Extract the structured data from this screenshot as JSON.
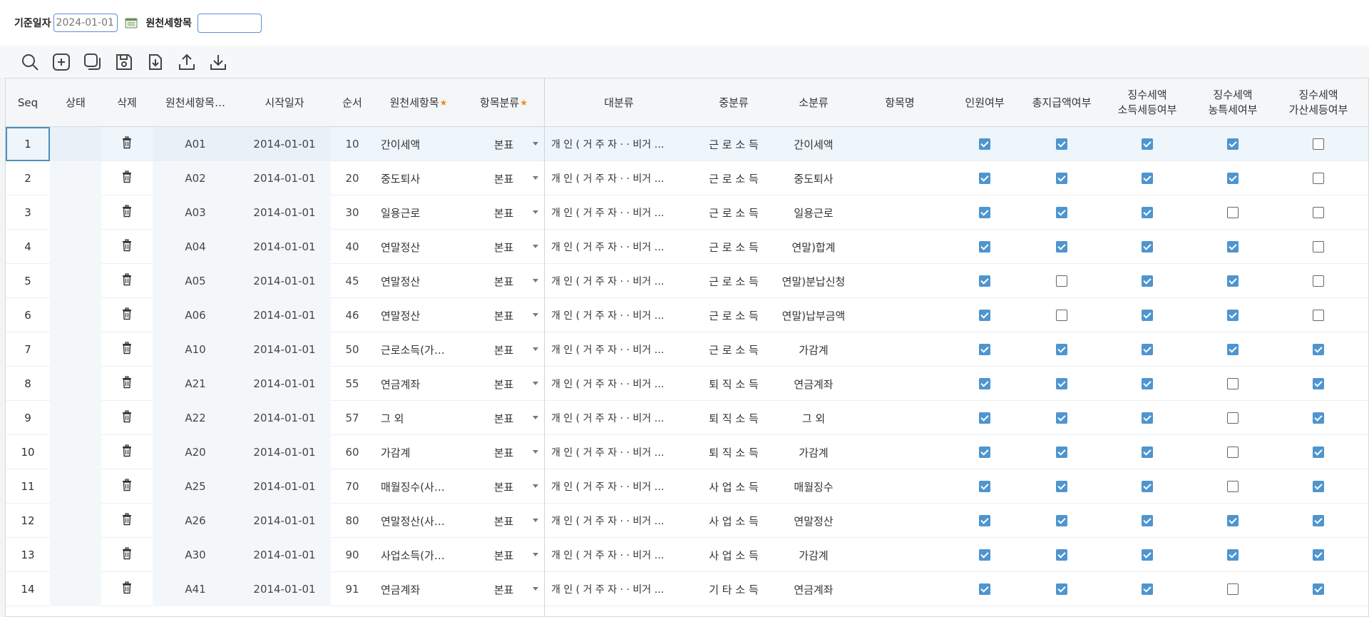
{
  "search": {
    "date_label": "기준일자",
    "date_value": "2024-01-01",
    "item_label": "원천세항목",
    "item_value": ""
  },
  "toolbar": {
    "buttons": [
      "search-icon",
      "add-icon",
      "copy-icon",
      "save-icon",
      "download-file-icon",
      "upload-icon",
      "download-icon"
    ]
  },
  "columns": {
    "seq": "Seq",
    "status": "상태",
    "delete": "삭제",
    "code": "원천세항목…",
    "start_date": "시작일자",
    "order": "순서",
    "item": "원천세항목",
    "category": "항목분류",
    "major": "대분류",
    "middle": "중분류",
    "minor": "소분류",
    "item_name": "항목명",
    "headcount": "인원여부",
    "total_pay": "총지급액여부",
    "income_tax_line1": "징수세액",
    "income_tax_line2": "소득세등여부",
    "rural_tax_line1": "징수세액",
    "rural_tax_line2": "농특세여부",
    "penalty_tax_line1": "징수세액",
    "penalty_tax_line2": "가산세등여부"
  },
  "rows": [
    {
      "seq": "1",
      "code": "A01",
      "start": "2014-01-01",
      "order": "10",
      "item": "간이세액",
      "category": "본표",
      "major": "개 인 ( 거 주 자 ·  · 비거 …",
      "middle": "근 로 소 득",
      "minor": "간이세액",
      "name": "",
      "headcount": true,
      "total": true,
      "income": true,
      "rural": true,
      "penalty": false
    },
    {
      "seq": "2",
      "code": "A02",
      "start": "2014-01-01",
      "order": "20",
      "item": "중도퇴사",
      "category": "본표",
      "major": "개 인 ( 거 주 자 ·  · 비거 …",
      "middle": "근 로 소 득",
      "minor": "중도퇴사",
      "name": "",
      "headcount": true,
      "total": true,
      "income": true,
      "rural": true,
      "penalty": false
    },
    {
      "seq": "3",
      "code": "A03",
      "start": "2014-01-01",
      "order": "30",
      "item": "일용근로",
      "category": "본표",
      "major": "개 인 ( 거 주 자 ·  · 비거 …",
      "middle": "근 로 소 득",
      "minor": "일용근로",
      "name": "",
      "headcount": true,
      "total": true,
      "income": true,
      "rural": false,
      "penalty": false
    },
    {
      "seq": "4",
      "code": "A04",
      "start": "2014-01-01",
      "order": "40",
      "item": "연말정산",
      "category": "본표",
      "major": "개 인 ( 거 주 자 ·  · 비거 …",
      "middle": "근 로 소 득",
      "minor": "연말)합계",
      "name": "",
      "headcount": true,
      "total": true,
      "income": true,
      "rural": true,
      "penalty": false
    },
    {
      "seq": "5",
      "code": "A05",
      "start": "2014-01-01",
      "order": "45",
      "item": "연말정산",
      "category": "본표",
      "major": "개 인 ( 거 주 자 ·  · 비거 …",
      "middle": "근 로 소 득",
      "minor": "연말)분납신청",
      "name": "",
      "headcount": true,
      "total": false,
      "income": true,
      "rural": true,
      "penalty": false
    },
    {
      "seq": "6",
      "code": "A06",
      "start": "2014-01-01",
      "order": "46",
      "item": "연말정산",
      "category": "본표",
      "major": "개 인 ( 거 주 자 ·  · 비거 …",
      "middle": "근 로 소 득",
      "minor": "연말)납부금액",
      "name": "",
      "headcount": true,
      "total": false,
      "income": true,
      "rural": true,
      "penalty": false
    },
    {
      "seq": "7",
      "code": "A10",
      "start": "2014-01-01",
      "order": "50",
      "item": "근로소득(가…",
      "category": "본표",
      "major": "개 인 ( 거 주 자 ·  · 비거 …",
      "middle": "근 로 소 득",
      "minor": "가감계",
      "name": "",
      "headcount": true,
      "total": true,
      "income": true,
      "rural": true,
      "penalty": true
    },
    {
      "seq": "8",
      "code": "A21",
      "start": "2014-01-01",
      "order": "55",
      "item": "연금계좌",
      "category": "본표",
      "major": "개 인 ( 거 주 자 ·  · 비거 …",
      "middle": "퇴 직 소 득",
      "minor": "연금계좌",
      "name": "",
      "headcount": true,
      "total": true,
      "income": true,
      "rural": false,
      "penalty": true
    },
    {
      "seq": "9",
      "code": "A22",
      "start": "2014-01-01",
      "order": "57",
      "item": "그 외",
      "category": "본표",
      "major": "개 인 ( 거 주 자 ·  · 비거 …",
      "middle": "퇴 직 소 득",
      "minor": "그 외",
      "name": "",
      "headcount": true,
      "total": true,
      "income": true,
      "rural": false,
      "penalty": true
    },
    {
      "seq": "10",
      "code": "A20",
      "start": "2014-01-01",
      "order": "60",
      "item": "가감계",
      "category": "본표",
      "major": "개 인 ( 거 주 자 ·  · 비거 …",
      "middle": "퇴 직 소 득",
      "minor": "가감계",
      "name": "",
      "headcount": true,
      "total": true,
      "income": true,
      "rural": false,
      "penalty": true
    },
    {
      "seq": "11",
      "code": "A25",
      "start": "2014-01-01",
      "order": "70",
      "item": "매월징수(사…",
      "category": "본표",
      "major": "개 인 ( 거 주 자 ·  · 비거 …",
      "middle": "사 업 소 득",
      "minor": "매월징수",
      "name": "",
      "headcount": true,
      "total": true,
      "income": true,
      "rural": false,
      "penalty": true
    },
    {
      "seq": "12",
      "code": "A26",
      "start": "2014-01-01",
      "order": "80",
      "item": "연말정산(사…",
      "category": "본표",
      "major": "개 인 ( 거 주 자 ·  · 비거 …",
      "middle": "사 업 소 득",
      "minor": "연말정산",
      "name": "",
      "headcount": true,
      "total": true,
      "income": true,
      "rural": true,
      "penalty": true
    },
    {
      "seq": "13",
      "code": "A30",
      "start": "2014-01-01",
      "order": "90",
      "item": "사업소득(가…",
      "category": "본표",
      "major": "개 인 ( 거 주 자 ·  · 비거 …",
      "middle": "사 업 소 득",
      "minor": "가감계",
      "name": "",
      "headcount": true,
      "total": true,
      "income": true,
      "rural": true,
      "penalty": true
    },
    {
      "seq": "14",
      "code": "A41",
      "start": "2014-01-01",
      "order": "91",
      "item": "연금계좌",
      "category": "본표",
      "major": "개 인 ( 거 주 자 ·  · 비거 …",
      "middle": "기 타 소 득",
      "minor": "연금계좌",
      "name": "",
      "headcount": true,
      "total": true,
      "income": true,
      "rural": false,
      "penalty": true
    }
  ]
}
